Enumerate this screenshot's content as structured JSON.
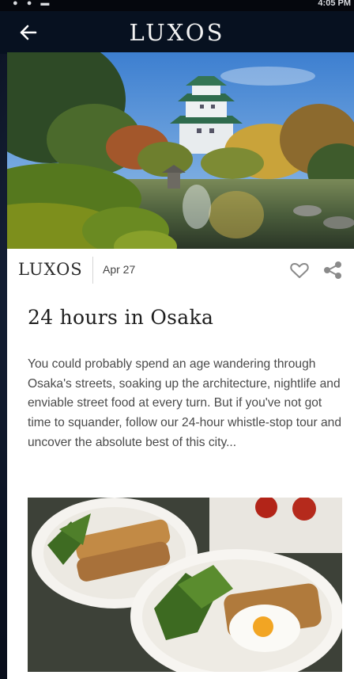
{
  "statusbar": {
    "left_glyphs": "● ● ▬",
    "right_text": "4:05 PM"
  },
  "appbar": {
    "brand": "LUXOS",
    "back_icon": "arrow-left-icon"
  },
  "article": {
    "hero_image": "osaka-castle-garden-photo",
    "publisher": "LUXOS",
    "date": "Apr 27",
    "actions": {
      "like_icon": "heart-outline-icon",
      "share_icon": "share-icon"
    },
    "title": "24 hours in Osaka",
    "excerpt": "You could probably spend an age wandering through Osaka's streets, soaking up the architecture, nightlife and enviable street food at every turn. But if you've not got time to squander, follow our 24-hour whistle-stop tour and uncover the absolute best of this city...",
    "body_image": "brunch-plates-photo"
  }
}
